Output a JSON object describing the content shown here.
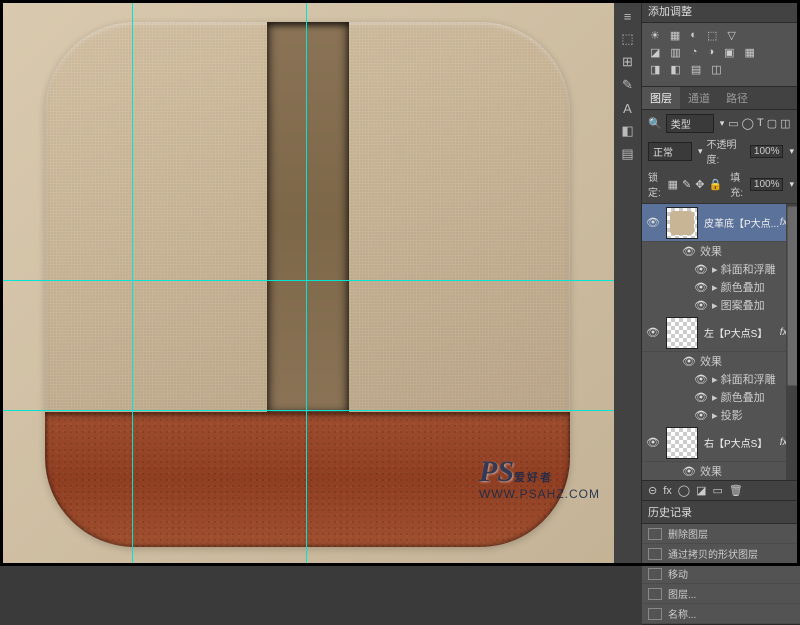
{
  "canvas": {
    "guide_h1": 280,
    "guide_h2": 410,
    "guide_v1": 132,
    "guide_v2": 306
  },
  "toolstrip": {
    "items": [
      "≡",
      "⬚",
      "⊞",
      "✎",
      "A",
      "◧",
      "▤"
    ]
  },
  "adjustments": {
    "title": "添加调整",
    "row1": [
      "☀",
      "▦",
      "◐",
      "⬚",
      "▽"
    ],
    "row2": [
      "◪",
      "▥",
      "◔",
      "◑",
      "▣",
      "▦"
    ],
    "row3": [
      "◨",
      "◧",
      "▤",
      "◫"
    ]
  },
  "layersPanel": {
    "tabs": [
      "图层",
      "通道",
      "路径"
    ],
    "activeTab": 0,
    "kindLabel": "类型",
    "kindIcons": [
      "▭",
      "◯",
      "T",
      "▢",
      "◫"
    ],
    "blendMode": "正常",
    "opacityLabel": "不透明度:",
    "opacity": "100%",
    "lockLabel": "锁定:",
    "lockIcons": [
      "▦",
      "✎",
      "✥",
      "🔒"
    ],
    "fillLabel": "填充:",
    "fill": "100%",
    "layers": [
      {
        "name": "皮革底【P大点...",
        "selected": true,
        "fx": true,
        "thumbColor": "#c8b596",
        "effects": [
          "效果",
          "斜面和浮雕",
          "颜色叠加",
          "图案叠加"
        ]
      },
      {
        "name": "左【P大点S】",
        "selected": false,
        "fx": true,
        "thumbColor": "transparent",
        "effects": [
          "效果",
          "斜面和浮雕",
          "颜色叠加",
          "投影"
        ]
      },
      {
        "name": "右【P大点S】",
        "selected": false,
        "fx": true,
        "thumbColor": "transparent",
        "effects": [
          "效果"
        ]
      }
    ],
    "footerIcons": [
      "⊝",
      "fx",
      "◯",
      "◪",
      "▭",
      "🗑"
    ]
  },
  "history": {
    "title": "历史记录",
    "items": [
      "删除图层",
      "通过拷贝的形状图层",
      "移动",
      "图层...",
      "名称..."
    ]
  },
  "watermark": {
    "ps": "PS",
    "txt": "爱好者",
    "url": "WWW.PSAHZ.COM"
  }
}
